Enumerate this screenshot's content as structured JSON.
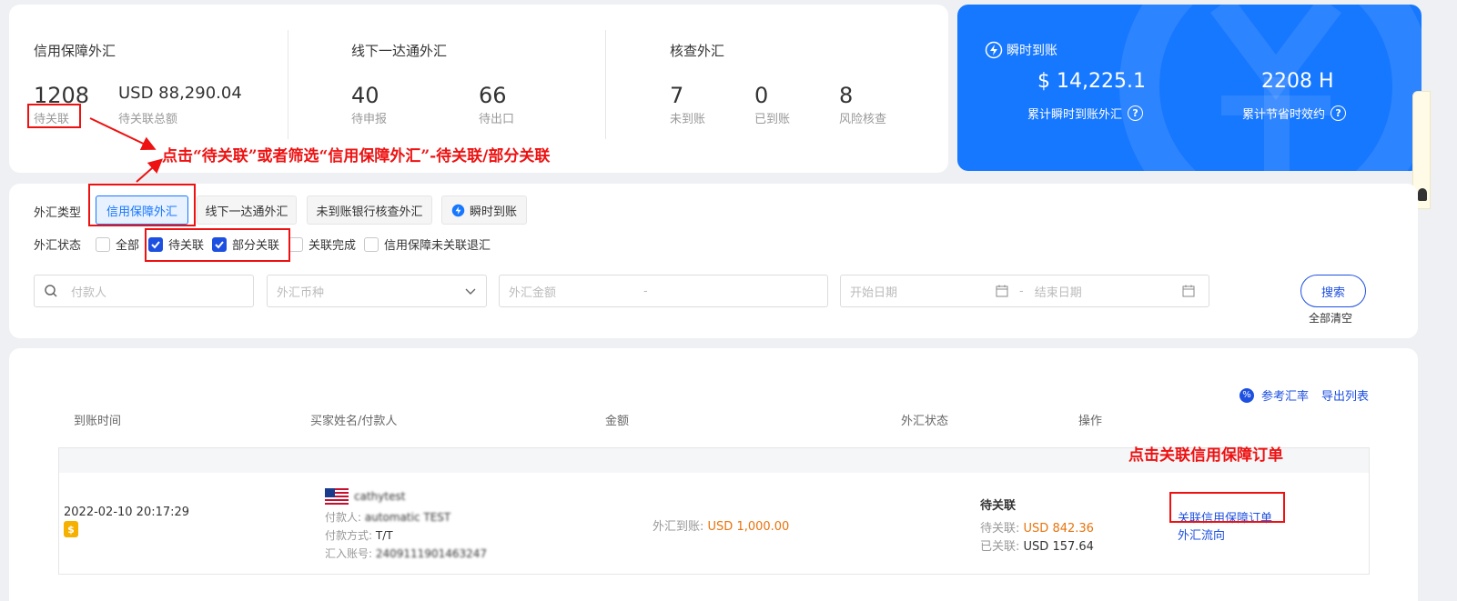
{
  "stats": {
    "credit": {
      "title": "信用保障外汇",
      "pending_count": "1208",
      "pending_label": "待关联",
      "total_amount": "USD 88,290.04",
      "total_label": "待关联总额"
    },
    "offline": {
      "title": "线下一达通外汇",
      "declare_count": "40",
      "declare_label": "待申报",
      "export_count": "66",
      "export_label": "待出口"
    },
    "verify": {
      "title": "核查外汇",
      "unarrived_count": "7",
      "unarrived_label": "未到账",
      "arrived_count": "0",
      "arrived_label": "已到账",
      "risk_count": "8",
      "risk_label": "风险核查"
    }
  },
  "instant": {
    "title": "瞬时到账",
    "amount": "$ 14,225.1",
    "amount_label": "累计瞬时到账外汇",
    "hours": "2208 H",
    "hours_label": "累计节省时效约",
    "bg_color": "#1677ff"
  },
  "annotations": {
    "top": "点击“待关联”或者筛选“信用保障外汇”-待关联/部分关联",
    "right": "点击关联信用保障订单"
  },
  "filters": {
    "type_label": "外汇类型",
    "types": [
      "信用保障外汇",
      "线下一达通外汇",
      "未到账银行核查外汇",
      "瞬时到账"
    ],
    "status_label": "外汇状态",
    "statuses": [
      {
        "label": "全部",
        "checked": false
      },
      {
        "label": "待关联",
        "checked": true
      },
      {
        "label": "部分关联",
        "checked": true
      },
      {
        "label": "关联完成",
        "checked": false
      },
      {
        "label": "信用保障未关联退汇",
        "checked": false
      }
    ],
    "payer_placeholder": "付款人",
    "currency_placeholder": "外汇币种",
    "amount_placeholder": "外汇金额",
    "amount_dash": "-",
    "start_date_placeholder": "开始日期",
    "date_dash": "-",
    "end_date_placeholder": "结束日期",
    "search_label": "搜索",
    "clear_label": "全部清空"
  },
  "table": {
    "ref_rate": "参考汇率",
    "export": "导出列表",
    "columns": [
      "到账时间",
      "买家姓名/付款人",
      "金额",
      "外汇状态",
      "操作"
    ],
    "rows": [
      {
        "time": "2022-02-10 20:17:29",
        "buyer": "cathytest",
        "payer_label": "付款人:",
        "payer": "automatic TEST",
        "method_label": "付款方式:",
        "method": "T/T",
        "account_label": "汇入账号:",
        "account": "2409111901463247",
        "amount_label": "外汇到账:",
        "amount": "USD 1,000.00",
        "status": "待关联",
        "pending_label": "待关联:",
        "pending": "USD 842.36",
        "linked_label": "已关联:",
        "linked": "USD 157.64",
        "action_link": "关联信用保障订单",
        "action_flow": "外汇流向"
      }
    ]
  }
}
